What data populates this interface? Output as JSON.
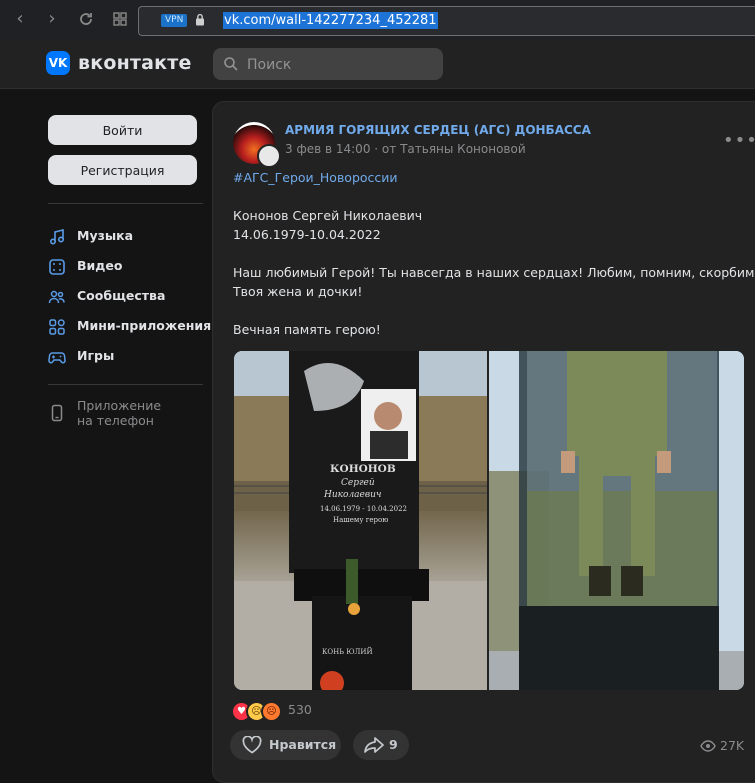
{
  "browser": {
    "vpn_label": "VPN",
    "url": "vk.com/wall-142277234_452281"
  },
  "header": {
    "brand": "вконтакте",
    "logo_text": "VK",
    "search_placeholder": "Поиск"
  },
  "sidebar": {
    "login_label": "Войти",
    "register_label": "Регистрация",
    "items": [
      {
        "label": "Музыка",
        "icon": "music-icon"
      },
      {
        "label": "Видео",
        "icon": "video-icon"
      },
      {
        "label": "Сообщества",
        "icon": "communities-icon"
      },
      {
        "label": "Мини-приложения",
        "icon": "mini-apps-icon"
      },
      {
        "label": "Игры",
        "icon": "games-icon"
      }
    ],
    "app_label_line1": "Приложение",
    "app_label_line2": "на телефон"
  },
  "post": {
    "group_name": "АРМИЯ ГОРЯЩИХ СЕРДЕЦ (АГС) ДОНБАССА",
    "date": "3 фев в 14:00",
    "author": "от Татьяны Кононовой",
    "hashtag": "#АГС_Герои_Новороссии",
    "lines": [
      "Кононов Сергей Николаевич",
      "14.06.1979-10.04.2022",
      "Наш любимый Герой! Ты навсегда в наших сердцах! Любим, помним, скорбим!",
      "Твоя жена и дочки!",
      "Вечная память герою!"
    ],
    "memorial": {
      "surname": "КОНОНОВ",
      "first_name": "Сергей",
      "patronymic": "Николаевич",
      "dates": "14.06.1979 - 10.04.2022",
      "dedication": "Нашему герою",
      "bottom_plate": "КОНЬ ЮЛИЙ"
    },
    "reactions_count": "530",
    "like_label": "Нравится",
    "share_count": "9",
    "views": "27K"
  }
}
